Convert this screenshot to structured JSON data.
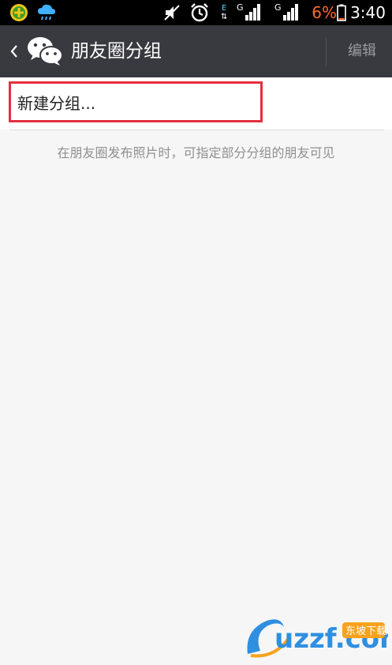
{
  "status_bar": {
    "battery_percent": "6%",
    "time": "3:40",
    "network_labels": [
      "E",
      "G",
      "G"
    ],
    "icons": [
      "app-notification-icon",
      "weather-icon",
      "mute-icon",
      "alarm-icon",
      "data-transfer-icon",
      "signal-icon",
      "signal-icon",
      "battery-icon"
    ]
  },
  "header": {
    "title": "朋友圈分组",
    "edit_label": "编辑"
  },
  "main": {
    "new_group_label": "新建分组...",
    "hint": "在朋友圈发布照片时，可指定部分分组的朋友可见"
  },
  "watermark": {
    "text": "uzzf.com",
    "brand_cn": "东坡下载"
  },
  "colors": {
    "titlebar": "#393a3f",
    "highlight": "#e3303f",
    "battery_low": "#ff6a2a",
    "background": "#f6f6f6"
  }
}
